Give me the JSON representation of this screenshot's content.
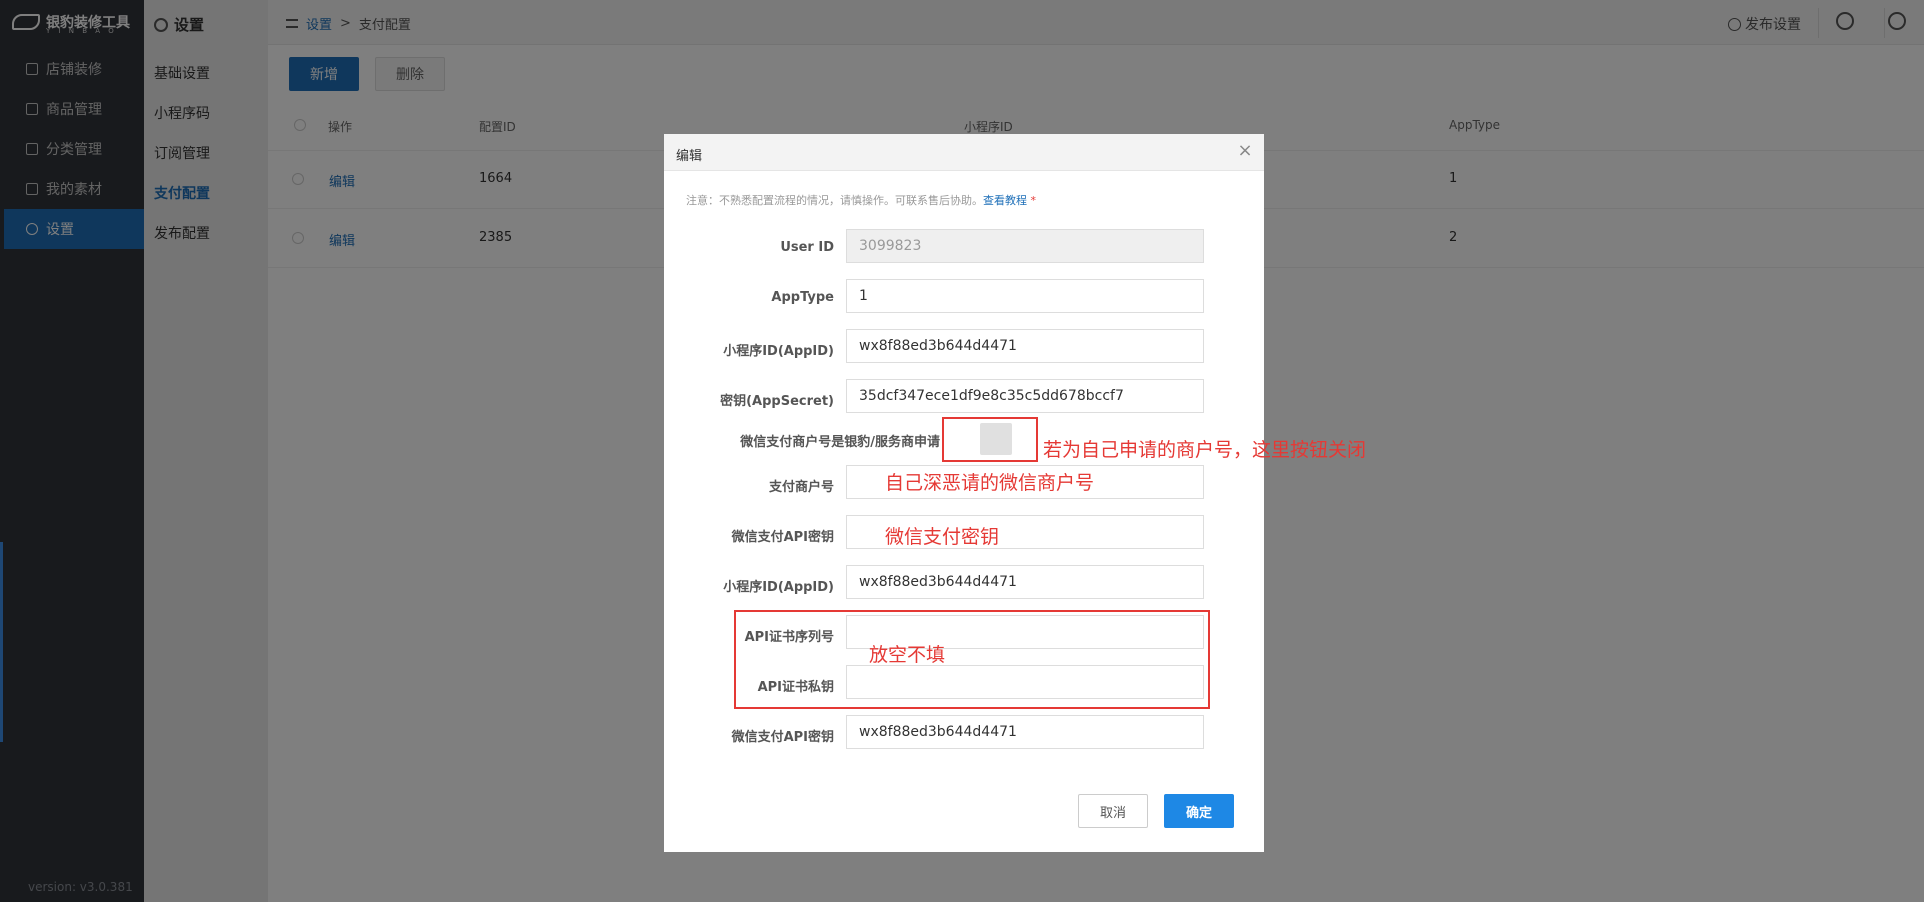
{
  "app": {
    "logo_text": "银豹装修工具",
    "logo_sub": "Y I N B A O",
    "version": "version: v3.0.381"
  },
  "sidebar": {
    "items": [
      {
        "label": "店铺装修"
      },
      {
        "label": "商品管理"
      },
      {
        "label": "分类管理"
      },
      {
        "label": "我的素材"
      },
      {
        "label": "设置"
      }
    ]
  },
  "subnav": {
    "title": "设置",
    "items": [
      {
        "label": "基础设置"
      },
      {
        "label": "小程序码"
      },
      {
        "label": "订阅管理"
      },
      {
        "label": "支付配置"
      },
      {
        "label": "发布配置"
      }
    ]
  },
  "header": {
    "crumb_root": "设置",
    "crumb_sep": ">",
    "crumb_current": "支付配置",
    "publish_label": "发布设置"
  },
  "toolbar": {
    "add_label": "新增",
    "delete_label": "删除"
  },
  "table": {
    "columns": [
      "操作",
      "配置ID",
      "小程序ID",
      "AppType"
    ],
    "rows": [
      {
        "action": "编辑",
        "config_id": "1664",
        "app_type": "1"
      },
      {
        "action": "编辑",
        "config_id": "2385",
        "app_type": "2"
      }
    ]
  },
  "modal": {
    "title": "编辑",
    "notice": "注意：不熟悉配置流程的情况，请慎操作。可联系售后协助。",
    "notice_link": "查看教程",
    "notice_star": "*",
    "fields": {
      "user_id": {
        "label": "User ID",
        "value": "3099823"
      },
      "app_type": {
        "label": "AppType",
        "value": "1"
      },
      "appid": {
        "label": "小程序ID(AppID)",
        "value": "wx8f88ed3b644d4471"
      },
      "secret": {
        "label": "密钥(AppSecret)",
        "value": "35dcf347ece1df9e8c35c5dd678bccf7"
      },
      "is_provider": {
        "label": "微信支付商户号是银豹/服务商申请"
      },
      "mch_id": {
        "label": "支付商户号",
        "value": ""
      },
      "api_key": {
        "label": "微信支付API密钥",
        "value": ""
      },
      "appid2": {
        "label": "小程序ID(AppID)",
        "value": "wx8f88ed3b644d4471"
      },
      "cert_serial": {
        "label": "API证书序列号",
        "value": ""
      },
      "cert_key": {
        "label": "API证书私钥",
        "value": ""
      },
      "api_key2": {
        "label": "微信支付API密钥",
        "value": "wx8f88ed3b644d4471"
      }
    },
    "cancel_label": "取消",
    "ok_label": "确定"
  },
  "annotations": {
    "toggle_note": "若为自己申请的商户号，这里按钮关闭",
    "mch_note": "自己深恶请的微信商户号",
    "api_key_note": "微信支付密钥",
    "cert_note": "放空不填"
  },
  "colors": {
    "accent": "#1e6fb8",
    "annotation": "#e53935",
    "sidebar_bg": "#30343b"
  }
}
